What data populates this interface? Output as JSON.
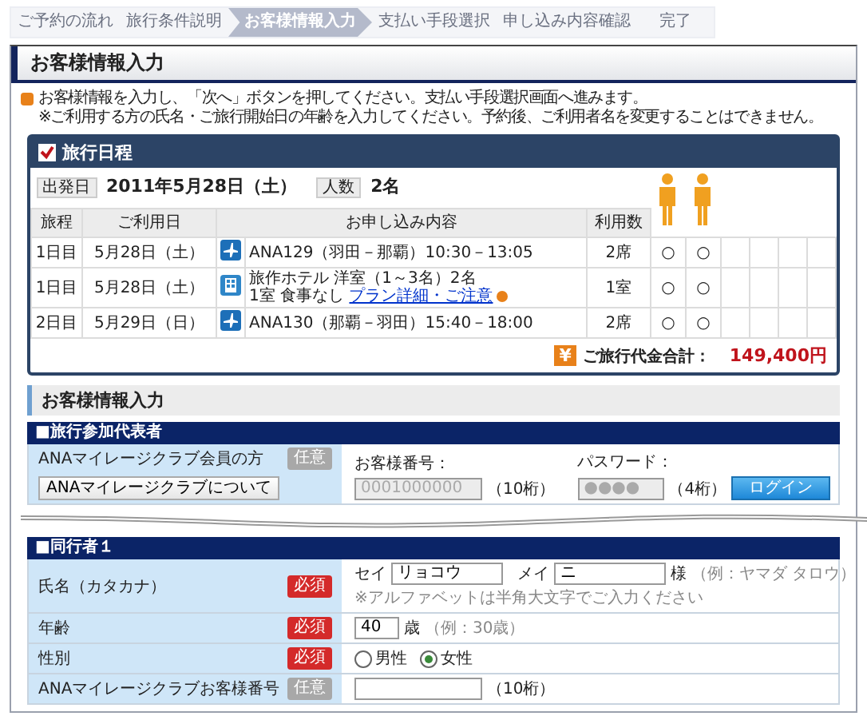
{
  "steps": [
    {
      "label": "ご予約の流れ",
      "selected": false
    },
    {
      "label": "旅行条件説明",
      "selected": false
    },
    {
      "label": "お客様情報入力",
      "selected": true
    },
    {
      "label": "支払い手段選択",
      "selected": false
    },
    {
      "label": "申し込み内容確認",
      "selected": false
    },
    {
      "label": "完了",
      "selected": false
    }
  ],
  "panel": {
    "title": "お客様情報入力"
  },
  "notice": {
    "lines": [
      "お客様情報を入力し、「次へ」ボタンを押してください。支払い手段選択画面へ進みます。",
      "※ご利用する方の氏名・ご旅行開始日の年齢を入力してください。予約後、ご利用者名を変更することはできません。"
    ]
  },
  "itinerary": {
    "title": "旅行日程",
    "departure_label": "出発日",
    "departure": "2011年5月28日（土）",
    "party_label": "人数",
    "party": "2名",
    "travelers": [
      {
        "kind": "adult"
      },
      {
        "kind": "adult"
      }
    ],
    "columns": [
      "旅程",
      "ご利用日",
      "お申し込み内容",
      "利用数"
    ],
    "rows": [
      {
        "day": "1日目",
        "date": "5月28日（土）",
        "kind": "flight",
        "lines": [
          "ANA129（羽田－那覇）10:30－13:05"
        ],
        "count": "2席",
        "marks": [
          "○",
          "○"
        ]
      },
      {
        "day": "1日目",
        "date": "5月28日（土）",
        "kind": "hotel",
        "lines": [
          "旅作ホテル 洋室（1～3名）2名",
          "1室 食事なし"
        ],
        "link": "プラン詳細・ご注意",
        "count": "1室",
        "marks": [
          "○",
          "○"
        ]
      },
      {
        "day": "2日目",
        "date": "5月29日（日）",
        "kind": "flight",
        "lines": [
          "ANA130（那覇－羽田）15:40－18:00"
        ],
        "count": "2席",
        "marks": [
          "○",
          "○"
        ]
      }
    ],
    "total_icon": "¥",
    "total_label": "ご旅行代金合計：",
    "total": "149,400円"
  },
  "section": {
    "title": "お客様情報入力"
  },
  "representative": {
    "title": "■旅行参加代表者",
    "label": "ANAマイレージクラブ会員の方",
    "badge": {
      "kind": "optional",
      "text": "任意"
    },
    "about_button": "ANAマイレージクラブについて",
    "number_label": "お客様番号：",
    "number_value": "0001000000",
    "number_hint": "（10桁）",
    "password_label": "パスワード：",
    "password_value": "●●●●",
    "password_hint": "（4桁）",
    "login_button": "ログイン"
  },
  "companion": {
    "title": "■同行者１",
    "name": {
      "label": "氏名（カタカナ）",
      "badge": {
        "kind": "required",
        "text": "必須"
      },
      "sei_label": "セイ",
      "sei": "リョコウ",
      "mei_label": "メイ",
      "mei": "ニ",
      "suffix": "様",
      "example": "（例：ヤマダ タロウ）",
      "note": "※アルファベットは半角大文字でご入力ください"
    },
    "age": {
      "label": "年齢",
      "badge": {
        "kind": "required",
        "text": "必須"
      },
      "value": "40",
      "unit": "歳",
      "example": "（例：30歳）"
    },
    "gender": {
      "label": "性別",
      "badge": {
        "kind": "required",
        "text": "必須"
      },
      "options": [
        {
          "label": "男性",
          "selected": false
        },
        {
          "label": "女性",
          "selected": true
        }
      ]
    },
    "mileage": {
      "label": "ANAマイレージクラブお客様番号",
      "badge": {
        "kind": "optional",
        "text": "任意"
      },
      "hint": "（10桁）"
    }
  }
}
